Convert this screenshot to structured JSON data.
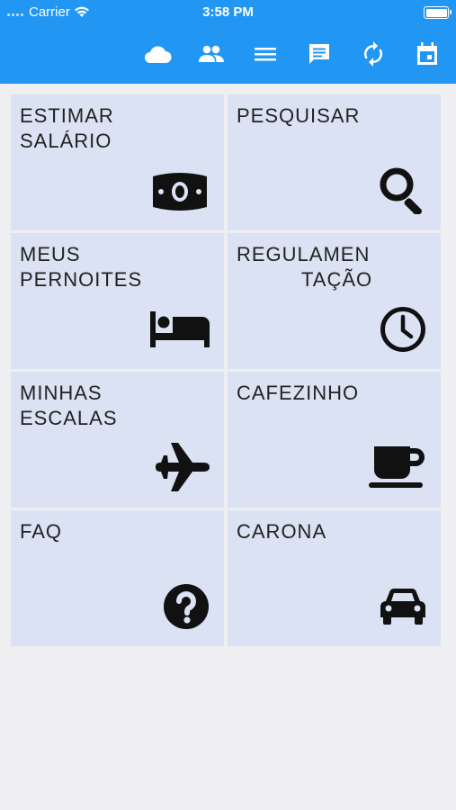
{
  "status_bar": {
    "carrier": "Carrier",
    "time": "3:58 PM"
  },
  "toolbar": {
    "icons": [
      "cloud-icon",
      "people-icon",
      "menu-icon",
      "chat-icon",
      "sync-icon",
      "calendar-icon"
    ]
  },
  "tiles": [
    {
      "label_line1": "ESTIMAR",
      "label_line2": "SALÁRIO",
      "icon": "money-icon"
    },
    {
      "label_line1": "PESQUISAR",
      "label_line2": "",
      "icon": "search-icon"
    },
    {
      "label_line1": "MEUS",
      "label_line2": "PERNOITES",
      "icon": "bed-icon"
    },
    {
      "label_line1": "REGULAMEN",
      "label_line2": "TAÇÃO",
      "icon": "clock-icon"
    },
    {
      "label_line1": "MINHAS",
      "label_line2": "ESCALAS",
      "icon": "airplane-icon"
    },
    {
      "label_line1": "CAFEZINHO",
      "label_line2": "",
      "icon": "coffee-icon"
    },
    {
      "label_line1": "FAQ",
      "label_line2": "",
      "icon": "help-icon"
    },
    {
      "label_line1": "CARONA",
      "label_line2": "",
      "icon": "car-icon"
    }
  ],
  "colors": {
    "header": "#2196f3",
    "tile": "#dae2f3",
    "background": "#efeef0"
  }
}
